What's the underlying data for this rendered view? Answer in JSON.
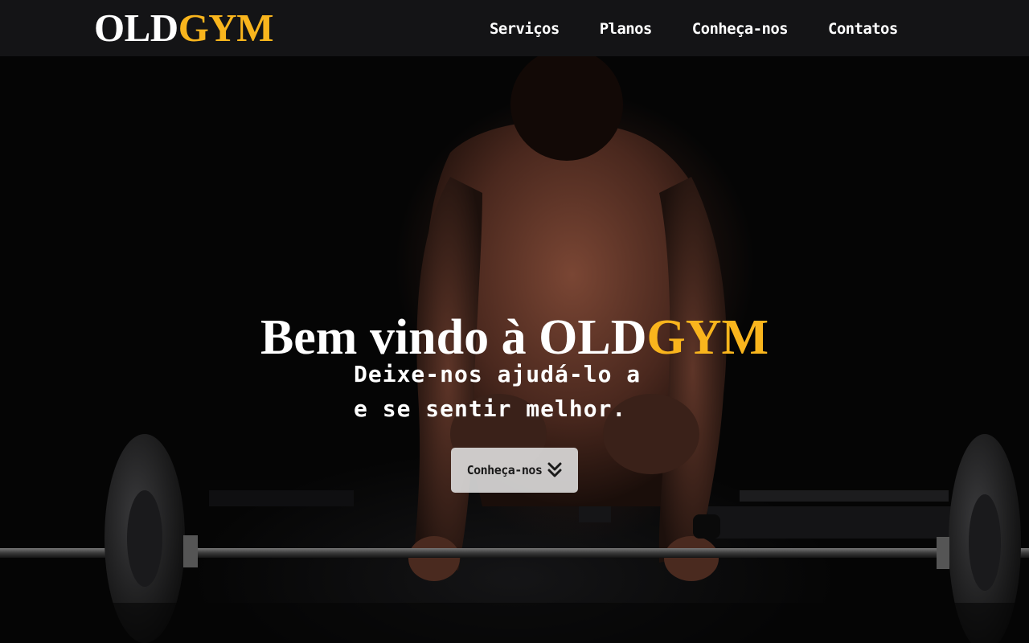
{
  "header": {
    "logo": {
      "part1": "OLD",
      "part2": "GYM"
    },
    "nav": [
      {
        "label": "Serviços"
      },
      {
        "label": "Planos"
      },
      {
        "label": "Conheça-nos"
      },
      {
        "label": "Contatos"
      }
    ]
  },
  "hero": {
    "title_prefix": "Bem vindo à ",
    "title_brand1": "OLD",
    "title_brand2": "GYM",
    "subtitle_lines": [
      "Deixe-nos ajudá-lo a",
      "e se sentir melhor."
    ],
    "cta": {
      "label": "Conheça-nos",
      "icon": "double-chevron-down-icon"
    },
    "background": "dark photo of a man lifting a barbell"
  },
  "colors": {
    "accent": "#f9b51d",
    "header_bg": "#141416",
    "text": "#ffffff",
    "button_bg": "#e1e1e1"
  }
}
